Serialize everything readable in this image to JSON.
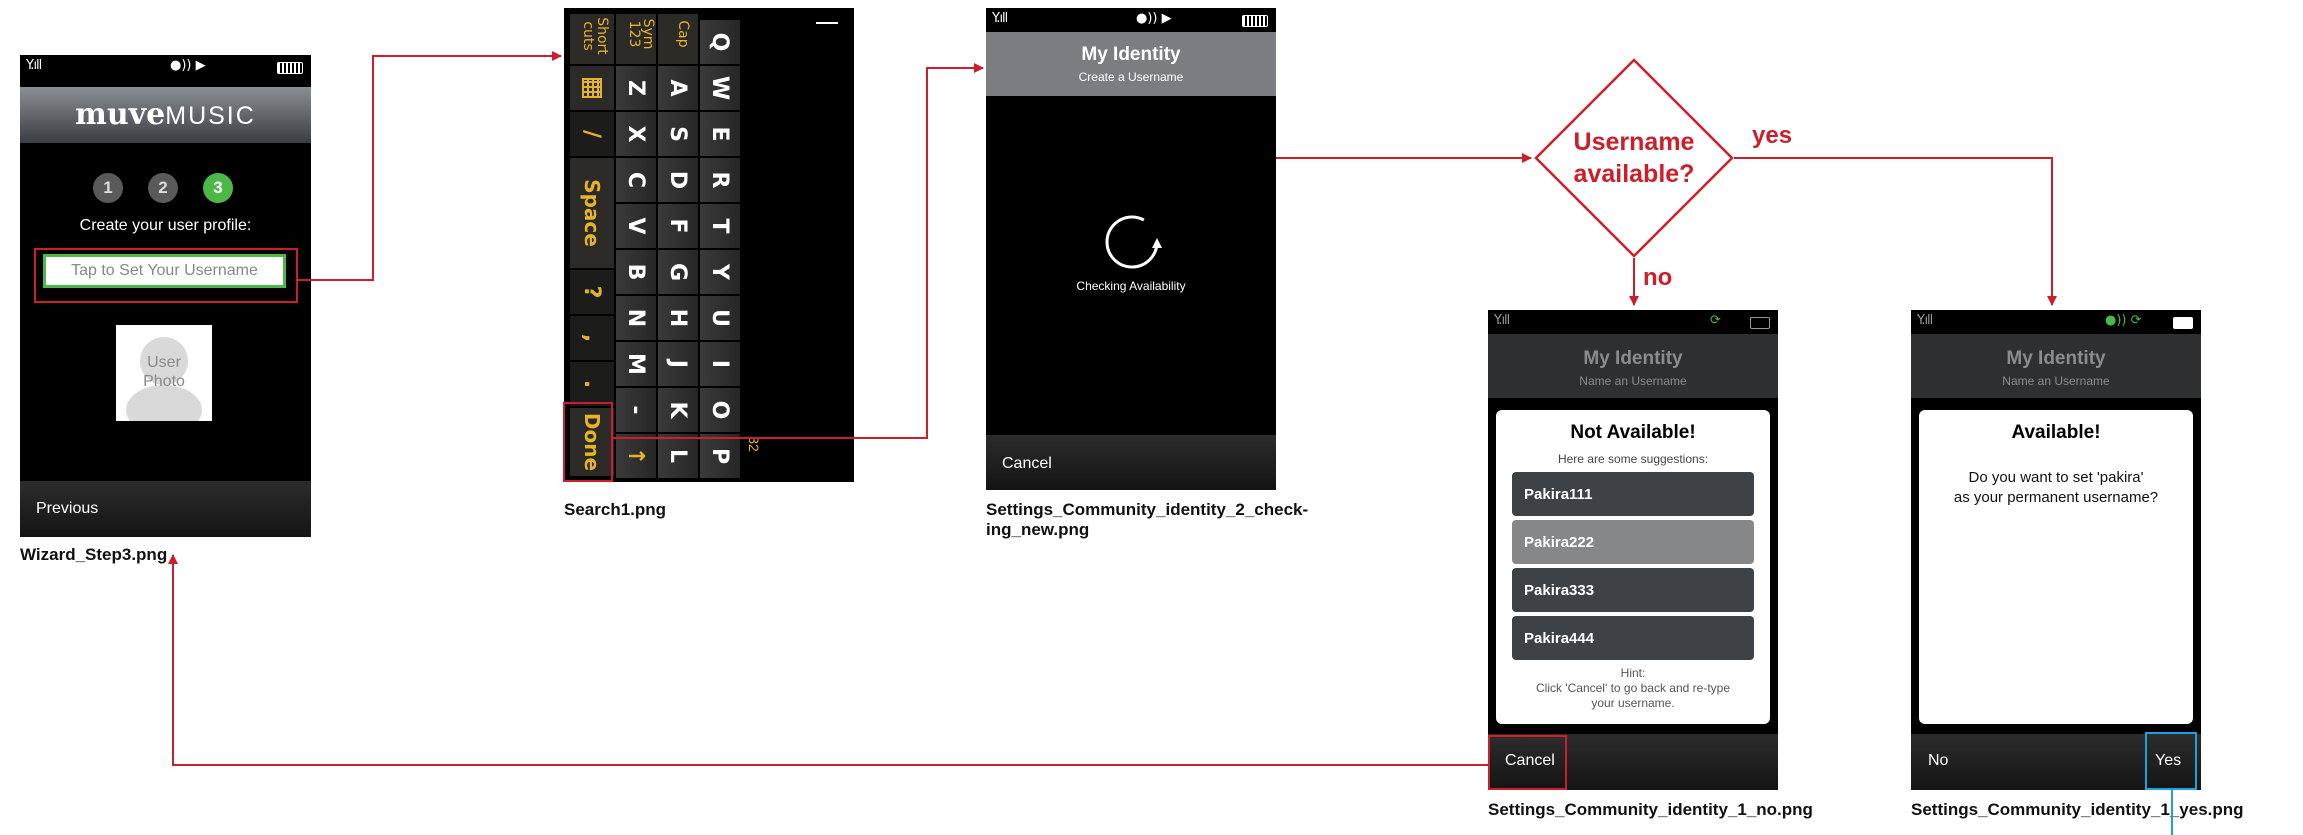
{
  "screen1": {
    "logo_bold": "muve",
    "logo_light": "MUSIC",
    "steps": [
      "1",
      "2",
      "3"
    ],
    "prompt": "Create your user profile:",
    "username_placeholder": "Tap to Set Your Username",
    "photo_label_1": "User",
    "photo_label_2": "Photo",
    "previous": "Previous",
    "caption": "Wizard_Step3.png"
  },
  "screen2": {
    "top_keys": [
      "Short cuts",
      "Sym 123",
      "Cap"
    ],
    "col_q": [
      "Q",
      "W",
      "E",
      "R",
      "T",
      "Y",
      "U",
      "I",
      "O",
      "P"
    ],
    "col_a": [
      "A",
      "S",
      "D",
      "F",
      "G",
      "H",
      "J",
      "K",
      "L"
    ],
    "col_z": [
      "Z",
      "X",
      "C",
      "V",
      "B",
      "N",
      "M",
      "-",
      "↑"
    ],
    "space": "Space",
    "slash": "/",
    "question": "?",
    "comma": ",",
    "period": ".",
    "done": "Done",
    "count": "32",
    "caption": "Search1.png"
  },
  "screen3": {
    "title": "My Identity",
    "subtitle": "Create a Username",
    "status": "Checking Availability",
    "cancel": "Cancel",
    "caption_line1": "Settings_Community_identity_2_check-",
    "caption_line2": "ing_new.png"
  },
  "decision": {
    "line1": "Username",
    "line2": "available?",
    "yes": "yes",
    "no": "no"
  },
  "screen4": {
    "title": "My Identity",
    "subtitle": "Name an Username",
    "dialog_title": "Not Available!",
    "suggestions_label": "Here are some suggestions:",
    "suggestions": [
      "Pakira111",
      "Pakira222",
      "Pakira333",
      "Pakira444"
    ],
    "hint_title": "Hint:",
    "hint_line1": "Click 'Cancel' to go back and re-type",
    "hint_line2": "your username.",
    "cancel": "Cancel",
    "caption": "Settings_Community_identity_1_no.png"
  },
  "screen5": {
    "title": "My Identity",
    "subtitle": "Name an Username",
    "dialog_title": "Available!",
    "question_line1": "Do you want to set 'pakira'",
    "question_line2": "as your permanent username?",
    "no": "No",
    "yes": "Yes",
    "caption": "Settings_Community_identity_1_yes.png"
  },
  "colors": {
    "flow_arrow": "#cc1f2b",
    "highlight_blue": "#1f9ee0",
    "accent_green": "#4cb848",
    "keyboard_yellow": "#e5b32a"
  }
}
